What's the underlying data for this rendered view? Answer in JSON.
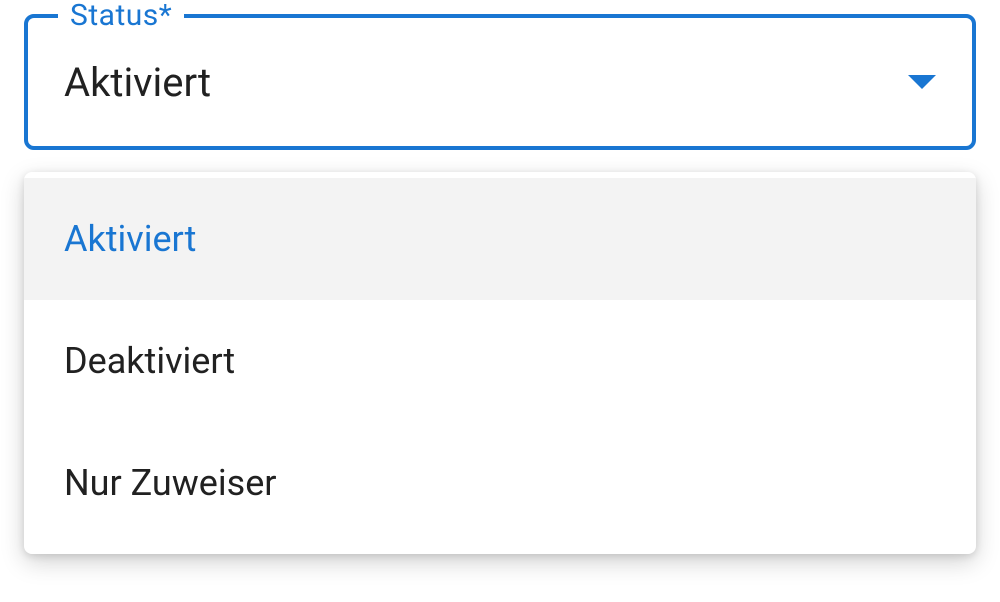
{
  "select": {
    "label": "Status*",
    "value": "Aktiviert",
    "options": [
      {
        "label": "Aktiviert",
        "selected": true
      },
      {
        "label": "Deaktiviert",
        "selected": false
      },
      {
        "label": "Nur Zuweiser",
        "selected": false
      }
    ]
  },
  "colors": {
    "primary": "#1976d2",
    "text": "#212121",
    "selected_bg": "#f3f3f3"
  }
}
